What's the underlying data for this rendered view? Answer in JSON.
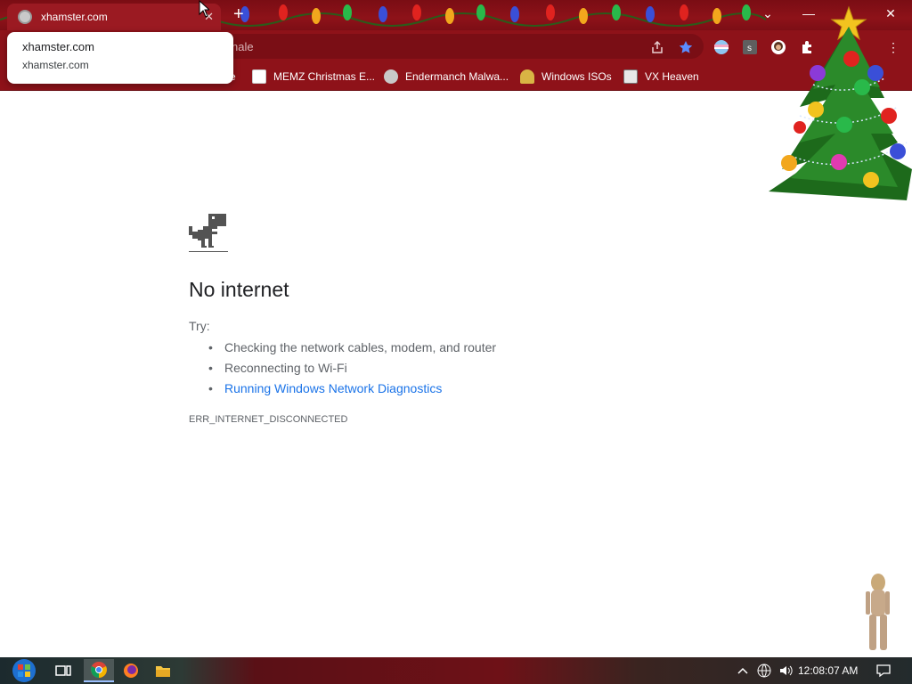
{
  "browser": {
    "tab": {
      "title": "xhamster.com"
    },
    "tooltip": {
      "title": "xhamster.com",
      "url": "xhamster.com"
    },
    "omnibox": {
      "visible_text": "nale"
    },
    "bookmarks": [
      {
        "label": "e",
        "icon": "partial-icon"
      },
      {
        "label": "MEMZ Christmas E...",
        "icon": "memz-icon"
      },
      {
        "label": "Endermanch Malwa...",
        "icon": "raccoon-icon"
      },
      {
        "label": "Windows ISOs",
        "icon": "windows-iso-icon"
      },
      {
        "label": "VX Heaven",
        "icon": "vx-heaven-icon"
      }
    ]
  },
  "error_page": {
    "heading": "No internet",
    "try_label": "Try:",
    "suggestions": [
      "Checking the network cables, modem, and router",
      "Reconnecting to Wi-Fi",
      "Running Windows Network Diagnostics"
    ],
    "error_code": "ERR_INTERNET_DISCONNECTED"
  },
  "taskbar": {
    "clock": "12:08:07 AM"
  },
  "colors": {
    "chrome_theme": "#8e1219",
    "link": "#1a73e8",
    "text": "#202124",
    "muted": "#5f6368"
  }
}
